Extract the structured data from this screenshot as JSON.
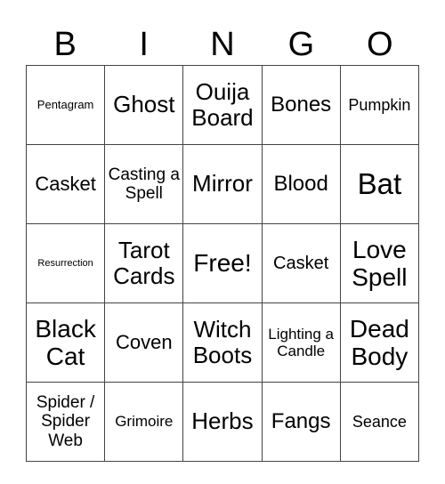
{
  "header": [
    "B",
    "I",
    "N",
    "G",
    "O"
  ],
  "rows": [
    [
      "Pentagram",
      "Ghost",
      "Ouija Board",
      "Bones",
      "Pumpkin"
    ],
    [
      "Casket",
      "Casting a Spell",
      "Mirror",
      "Blood",
      "Bat"
    ],
    [
      "Resurrection",
      "Tarot Cards",
      "Free!",
      "Casket",
      "Love Spell"
    ],
    [
      "Black Cat",
      "Coven",
      "Witch Boots",
      "Lighting a Candle",
      "Dead Body"
    ],
    [
      "Spider / Spider Web",
      "Grimoire",
      "Herbs",
      "Fangs",
      "Seance"
    ]
  ]
}
